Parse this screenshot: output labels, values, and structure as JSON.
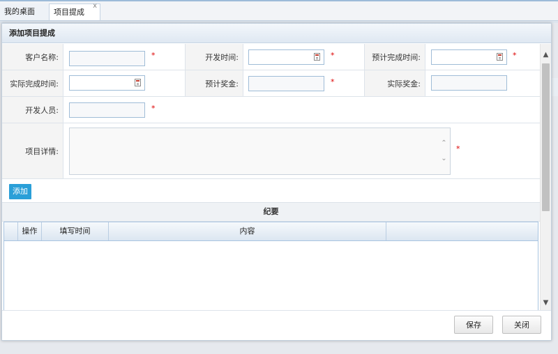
{
  "tabs": [
    {
      "label": "我的桌面"
    },
    {
      "label": "项目提成",
      "close": "x"
    }
  ],
  "dialog": {
    "title": "添加项目提成",
    "fields": {
      "customer_name": {
        "label": "客户名称:",
        "value": "",
        "required": "*"
      },
      "dev_time": {
        "label": "开发时间:",
        "value": "",
        "required": "*"
      },
      "expected_finish": {
        "label": "预计完成时间:",
        "value": "",
        "required": "*"
      },
      "actual_finish": {
        "label": "实际完成时间:",
        "value": ""
      },
      "expected_bonus": {
        "label": "预计奖金:",
        "value": "",
        "required": "*"
      },
      "actual_bonus": {
        "label": "实际奖金:",
        "value": ""
      },
      "developer": {
        "label": "开发人员:",
        "value": "",
        "required": "*"
      },
      "details": {
        "label": "项目详情:",
        "value": "",
        "required": "*"
      }
    },
    "add_button": "添加",
    "summary_title": "纪要",
    "grid": {
      "columns": [
        "操作",
        "填写时间",
        "内容"
      ],
      "rows": []
    },
    "footer": {
      "save": "保存",
      "close": "关闭"
    }
  },
  "icons": [
    "calendar-icon",
    "close-icon",
    "scroll-up-icon",
    "scroll-down-icon"
  ]
}
